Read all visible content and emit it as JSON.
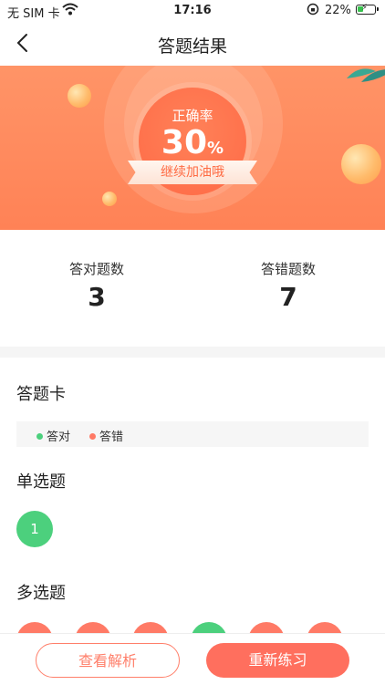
{
  "status": {
    "carrier": "无 SIM 卡",
    "time": "17:16",
    "battery": "22%"
  },
  "nav": {
    "title": "答题结果"
  },
  "result": {
    "label": "正确率",
    "percent": "30",
    "percent_sign": "%",
    "encouragement": "继续加油哦"
  },
  "stats": {
    "correct_label": "答对题数",
    "correct_value": "3",
    "wrong_label": "答错题数",
    "wrong_value": "7"
  },
  "answer_card": {
    "title": "答题卡",
    "legend_correct": "答对",
    "legend_wrong": "答错",
    "single_title": "单选题",
    "single_items": [
      {
        "label": "1",
        "status": "correct"
      }
    ],
    "multi_title": "多选题",
    "multi_items": [
      {
        "label": "",
        "status": "wrong"
      },
      {
        "label": "",
        "status": "wrong"
      },
      {
        "label": "",
        "status": "wrong"
      },
      {
        "label": "",
        "status": "correct"
      },
      {
        "label": "",
        "status": "wrong"
      },
      {
        "label": "",
        "status": "wrong"
      }
    ]
  },
  "colors": {
    "correct": "#4cd07d",
    "wrong": "#ff7a66",
    "accent": "#ff6f5e"
  },
  "buttons": {
    "review": "查看解析",
    "retry": "重新练习"
  }
}
